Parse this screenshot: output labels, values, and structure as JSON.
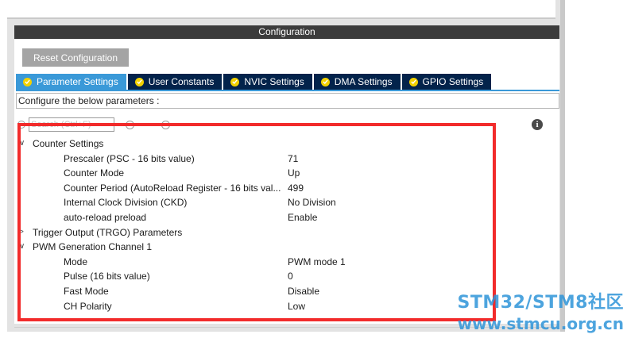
{
  "panel": {
    "title": "Configuration",
    "reset_label": "Reset Configuration",
    "tabs": [
      {
        "label": "Parameter Settings",
        "active": true
      },
      {
        "label": "User Constants",
        "active": false
      },
      {
        "label": "NVIC Settings",
        "active": false
      },
      {
        "label": "DMA Settings",
        "active": false
      },
      {
        "label": "GPIO Settings",
        "active": false
      }
    ],
    "description": "Configure the below parameters :",
    "search_placeholder": "Search (Ctrl+F)",
    "info_glyph": "i"
  },
  "tree": {
    "counter_settings": {
      "label": "Counter Settings",
      "expanded": true,
      "params": [
        {
          "label": "Prescaler (PSC - 16 bits value)",
          "value": "71"
        },
        {
          "label": "Counter Mode",
          "value": "Up"
        },
        {
          "label": "Counter Period (AutoReload Register - 16 bits val...",
          "value": "499"
        },
        {
          "label": "Internal Clock Division (CKD)",
          "value": "No Division"
        },
        {
          "label": "auto-reload preload",
          "value": "Enable"
        }
      ]
    },
    "trigger_output": {
      "label": "Trigger Output (TRGO) Parameters",
      "expanded": false
    },
    "pwm_channel1": {
      "label": "PWM Generation Channel 1",
      "expanded": true,
      "params": [
        {
          "label": "Mode",
          "value": "PWM mode 1"
        },
        {
          "label": "Pulse (16 bits value)",
          "value": "0"
        },
        {
          "label": "Fast Mode",
          "value": "Disable"
        },
        {
          "label": "CH Polarity",
          "value": "Low"
        }
      ]
    }
  },
  "watermark": {
    "line1": "STM32/STM8社区",
    "line2": "www.stmcu.org.cn"
  },
  "colors": {
    "tab_active": "#3a99d8",
    "tab_inactive": "#03234b",
    "check": "#f2d100",
    "highlight_box": "#f22b2b",
    "watermark": "#2f95d9"
  }
}
